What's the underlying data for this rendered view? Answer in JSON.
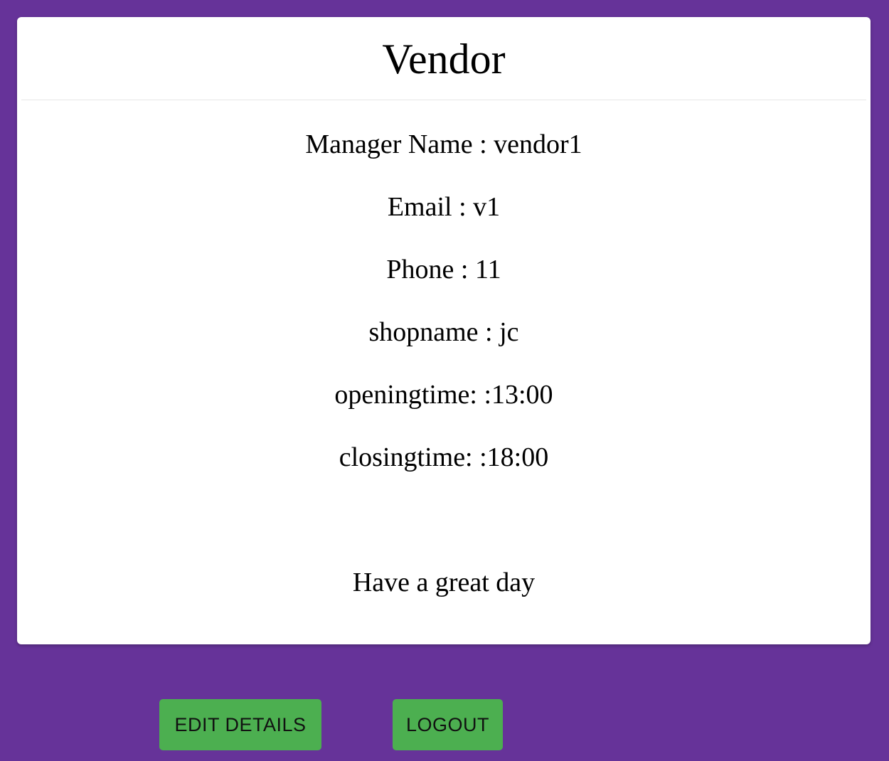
{
  "card": {
    "title": "Vendor",
    "details": {
      "manager": "Manager Name : vendor1",
      "email": "Email : v1",
      "phone": "Phone : 11",
      "shopname": "shopname : jc",
      "openingtime": "openingtime: :13:00",
      "closingtime": "closingtime: :18:00"
    },
    "greeting": "Have a great day"
  },
  "actions": {
    "edit_label": "EDIT DETAILS",
    "logout_label": "LOGOUT"
  },
  "colors": {
    "background": "#663399",
    "button": "#4caf50"
  }
}
